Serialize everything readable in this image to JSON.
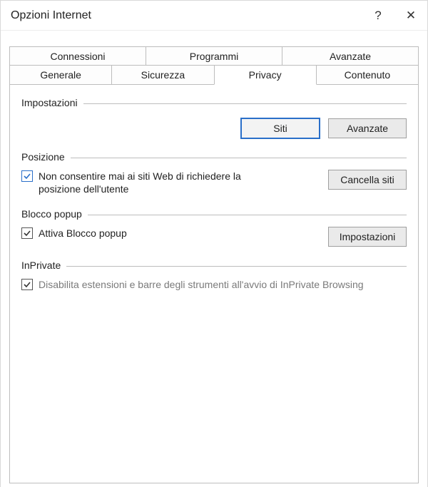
{
  "window": {
    "title": "Opzioni Internet",
    "help_symbol": "?",
    "close_symbol": "✕"
  },
  "tabs": {
    "row1": [
      "Connessioni",
      "Programmi",
      "Avanzate"
    ],
    "row2": [
      "Generale",
      "Sicurezza",
      "Privacy",
      "Contenuto"
    ],
    "active": "Privacy"
  },
  "sections": {
    "impostazioni": {
      "title": "Impostazioni",
      "btn_siti": "Siti",
      "btn_avanzate": "Avanzate"
    },
    "posizione": {
      "title": "Posizione",
      "check_label": "Non consentire mai ai siti Web di richiedere la posizione dell'utente",
      "checked": true,
      "btn_cancella": "Cancella siti"
    },
    "blocco_popup": {
      "title": "Blocco popup",
      "check_label": "Attiva Blocco popup",
      "checked": true,
      "btn_impostazioni": "Impostazioni"
    },
    "inprivate": {
      "title": "InPrivate",
      "check_label": "Disabilita estensioni e barre degli strumenti all'avvio di InPrivate Browsing",
      "checked": true
    }
  }
}
